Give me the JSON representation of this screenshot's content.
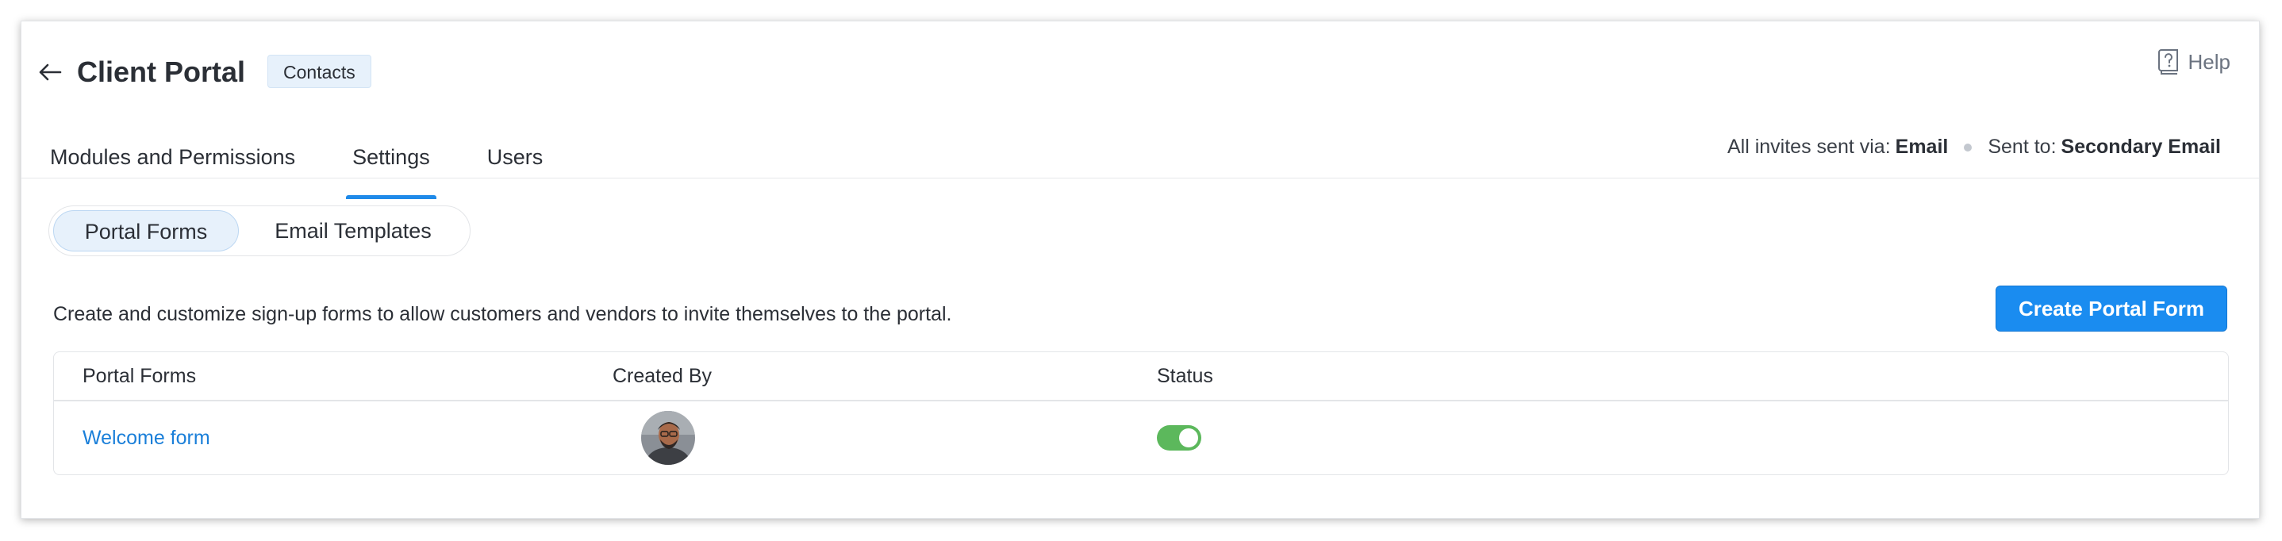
{
  "header": {
    "title": "Client Portal",
    "module_badge": "Contacts",
    "help_label": "Help",
    "back_icon": "arrow-left-icon",
    "help_icon": "help-book-icon"
  },
  "tabs": [
    {
      "label": "Modules and Permissions",
      "active": false
    },
    {
      "label": "Settings",
      "active": true
    },
    {
      "label": "Users",
      "active": false
    }
  ],
  "invites": {
    "via_label": "All invites sent via:",
    "via_value": "Email",
    "sent_to_label": "Sent to:",
    "sent_to_value": "Secondary Email"
  },
  "subtabs": [
    {
      "label": "Portal Forms",
      "active": true
    },
    {
      "label": "Email Templates",
      "active": false
    }
  ],
  "main": {
    "description": "Create and customize sign-up forms to allow customers and vendors to invite themselves to the portal.",
    "create_button": "Create Portal Form"
  },
  "table": {
    "columns": [
      "Portal Forms",
      "Created By",
      "Status"
    ],
    "rows": [
      {
        "form_name": "Welcome form",
        "created_by": "avatar",
        "status_enabled": true
      }
    ]
  },
  "colors": {
    "accent": "#1a8cf0",
    "link": "#1a7fd9",
    "toggle_on": "#5cb85c",
    "badge_bg": "#e7f1fb"
  }
}
